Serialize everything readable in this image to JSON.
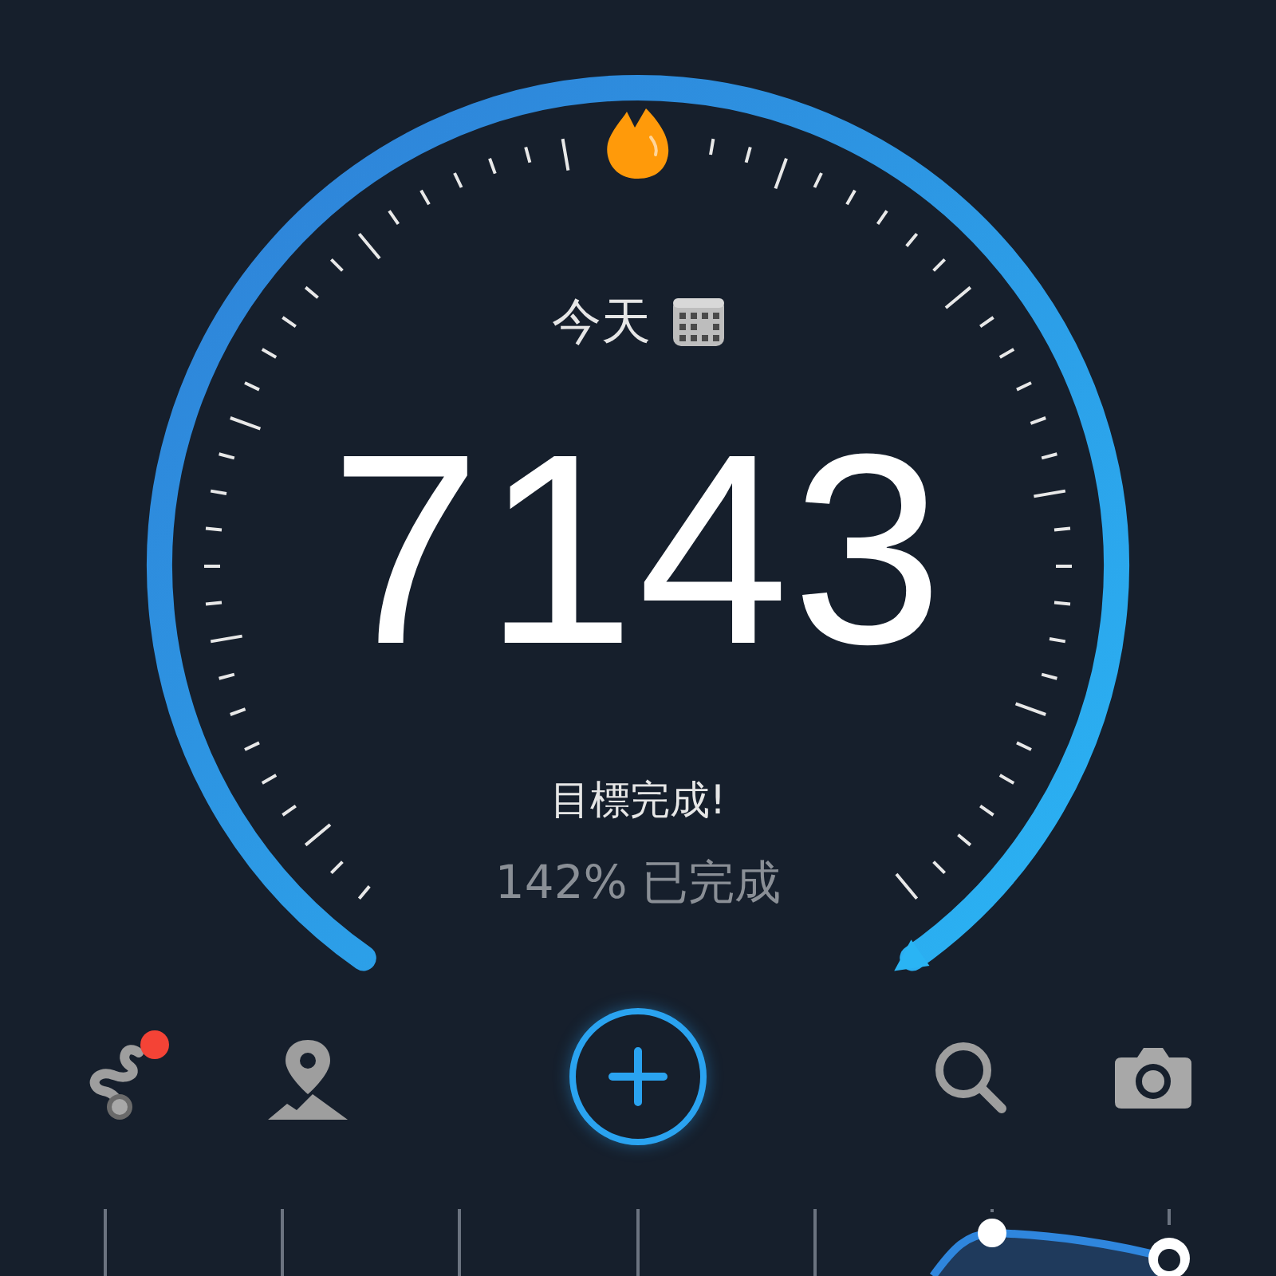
{
  "header": {
    "label": "今天"
  },
  "steps": "7143",
  "status": "目標完成!",
  "progress_text": "142% 已完成",
  "toolbar": {
    "route_badge": true
  }
}
